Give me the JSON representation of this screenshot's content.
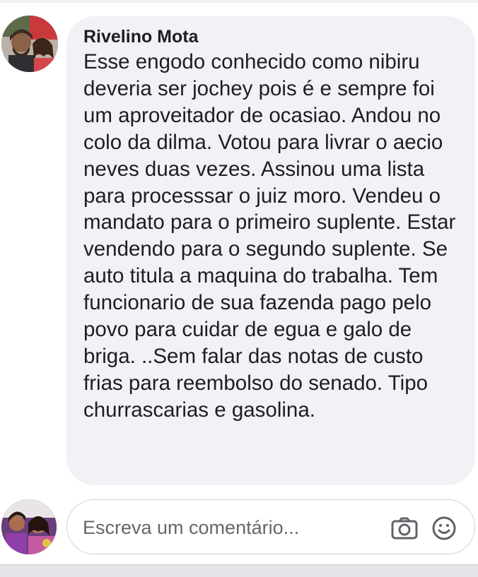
{
  "comment": {
    "author": "Rivelino Mota",
    "text": "Esse engodo conhecido como nibiru deveria ser jochey pois é e sempre foi um aproveitador de ocasiao. Andou no colo da dilma. Votou para livrar o aecio neves duas vezes. Assinou uma lista para processsar o juiz moro. Vendeu o mandato para o primeiro suplente. Estar vendendo para o segundo suplente. Se auto titula a maquina do trabalha. Tem funcionario de sua fazenda pago pelo povo para cuidar de egua e galo de briga. ..Sem falar das notas de custo frias para reembolso do senado. Tipo churrascarias e gasolina.",
    "avatar_icon": "user-photo-avatar"
  },
  "reply": {
    "placeholder": "Escreva um comentário...",
    "avatar_icon": "current-user-avatar",
    "camera_icon": "camera-icon",
    "emoji_icon": "emoji-icon"
  },
  "colors": {
    "bubble_background": "#f1f2f6",
    "text": "#1c1e21",
    "placeholder": "#65676b",
    "input_border": "#ccd0d5"
  }
}
